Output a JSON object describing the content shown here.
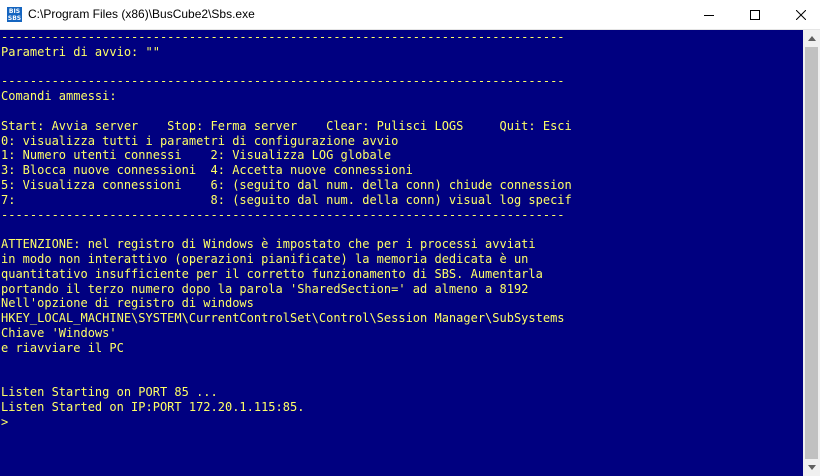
{
  "window": {
    "title": "C:\\Program Files (x86)\\BusCube2\\Sbs.exe",
    "icon_label": "BIS\nSBS"
  },
  "console": {
    "text_color": "#ffff66",
    "background": "#000080",
    "lines": [
      "------------------------------------------------------------------------------",
      "Parametri di avvio: \"\"",
      "",
      "------------------------------------------------------------------------------",
      "Comandi ammessi:",
      "",
      "Start: Avvia server    Stop: Ferma server    Clear: Pulisci LOGS     Quit: Esci",
      "0: visualizza tutti i parametri di configurazione avvio",
      "1: Numero utenti connessi    2: Visualizza LOG globale",
      "3: Blocca nuove connessioni  4: Accetta nuove connessioni",
      "5: Visualizza connessioni    6: (seguito dal num. della conn) chiude connession",
      "7:                           8: (seguito dal num. della conn) visual log specif",
      "------------------------------------------------------------------------------",
      "",
      "ATTENZIONE: nel registro di Windows è impostato che per i processi avviati",
      "in modo non interattivo (operazioni pianificate) la memoria dedicata è un",
      "quantitativo insufficiente per il corretto funzionamento di SBS. Aumentarla",
      "portando il terzo numero dopo la parola 'SharedSection=' ad almeno a 8192",
      "Nell'opzione di registro di windows",
      "HKEY_LOCAL_MACHINE\\SYSTEM\\CurrentControlSet\\Control\\Session Manager\\SubSystems",
      "Chiave 'Windows'",
      "e riavviare il PC",
      "",
      "",
      "Listen Starting on PORT 85 ...",
      "Listen Started on IP:PORT 172.20.1.115:85.",
      ">"
    ]
  }
}
